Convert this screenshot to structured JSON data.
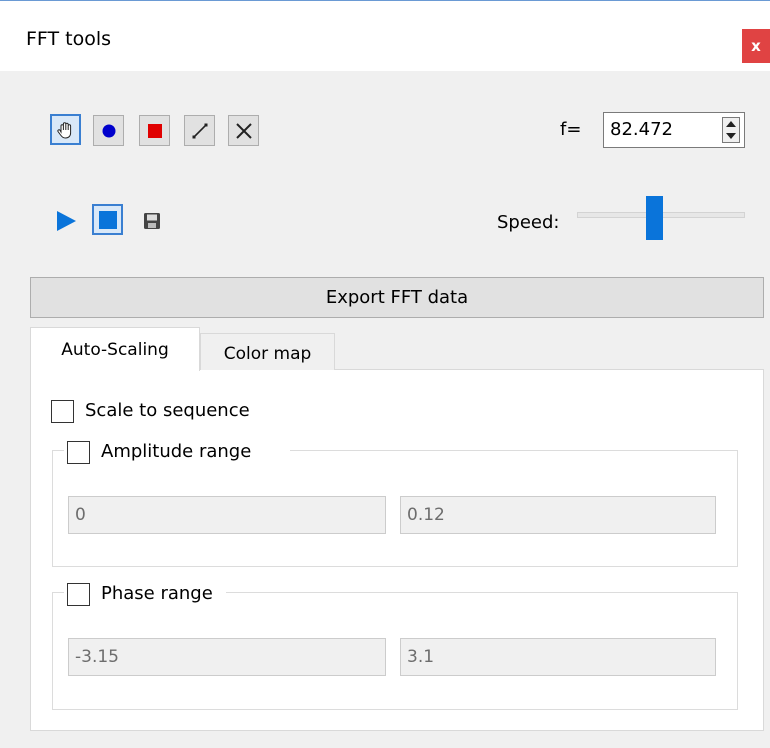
{
  "window": {
    "title": "FFT tools",
    "close_label": "x"
  },
  "toolbar": {
    "tools": [
      "hand-icon",
      "circle-icon",
      "square-icon",
      "line-icon",
      "x-icon"
    ],
    "playback": [
      "play-icon",
      "stop-icon",
      "save-icon"
    ]
  },
  "frequency": {
    "label": "f=",
    "value": "82.472"
  },
  "speed": {
    "label": "Speed:",
    "level": 0.46
  },
  "export_button": "Export FFT data",
  "tabs": [
    {
      "label": "Auto-Scaling"
    },
    {
      "label": "Color map"
    }
  ],
  "autoscaling": {
    "scale_to_sequence": {
      "label": "Scale to sequence",
      "checked": false
    },
    "amplitude": {
      "label": "Amplitude range",
      "checked": false,
      "min": "0",
      "max": "0.12"
    },
    "phase": {
      "label": "Phase range",
      "checked": false,
      "min": "-3.15",
      "max": "3.1"
    }
  },
  "colors": {
    "accent": "#0a74da",
    "close": "#e04343",
    "record": "#e00000",
    "dot": "#0000cc"
  }
}
